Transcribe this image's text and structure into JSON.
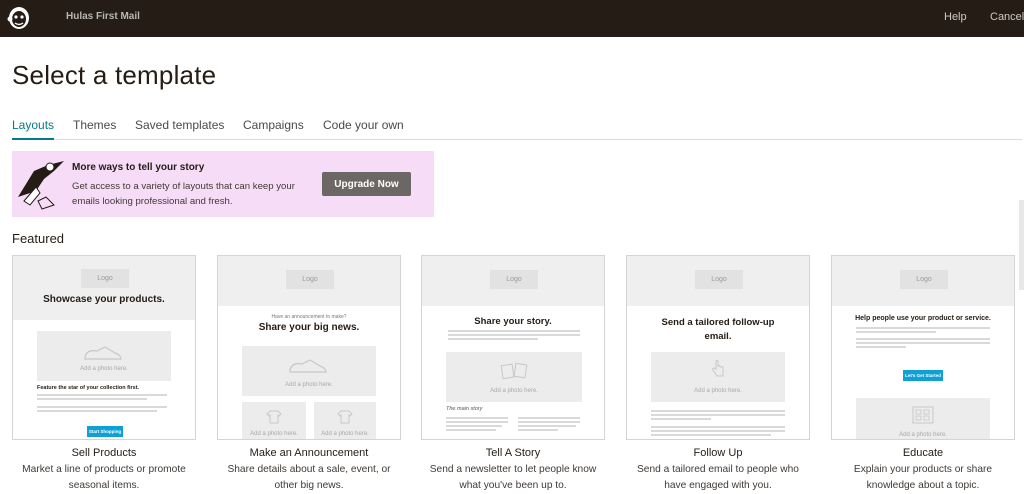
{
  "topbar": {
    "campaign_name": "Hulas First Mail",
    "help": "Help",
    "cancel": "Cancel"
  },
  "page_title": "Select a template",
  "tabs": [
    {
      "label": "Layouts",
      "active": true
    },
    {
      "label": "Themes",
      "active": false
    },
    {
      "label": "Saved templates",
      "active": false
    },
    {
      "label": "Campaigns",
      "active": false
    },
    {
      "label": "Code your own",
      "active": false
    }
  ],
  "promo": {
    "title": "More ways to tell your story",
    "text": "Get access to a variety of layouts that can keep your emails looking professional and fresh.",
    "button": "Upgrade Now"
  },
  "featured_heading": "Featured",
  "templates": [
    {
      "title": "Sell Products",
      "description": "Market a line of products or promote seasonal items.",
      "thumb": {
        "logo": "Logo",
        "headline": "Showcase your products.",
        "photo": "Add a photo here.",
        "feature": "Feature the star of your collection first.",
        "button": "Start Shopping"
      }
    },
    {
      "title": "Make an Announcement",
      "description": "Share details about a sale, event, or other big news.",
      "thumb": {
        "logo": "Logo",
        "kicker": "Have an announcement to make?",
        "headline": "Share your big news.",
        "photo": "Add a photo here.",
        "photo_small_1": "Add a photo here.",
        "photo_small_2": "Add a photo here."
      }
    },
    {
      "title": "Tell A Story",
      "description": "Send a newsletter to let people know what you've been up to.",
      "thumb": {
        "logo": "Logo",
        "headline": "Share your story.",
        "photo": "Add a photo here.",
        "main_story": "The main story"
      }
    },
    {
      "title": "Follow Up",
      "description": "Send a tailored email to people who have engaged with you.",
      "thumb": {
        "logo": "Logo",
        "headline": "Send a tailored follow-up email.",
        "photo": "Add a photo here."
      }
    },
    {
      "title": "Educate",
      "description": "Explain your products or share knowledge about a topic.",
      "thumb": {
        "logo": "Logo",
        "headline": "Help people use your product or service.",
        "button": "Let's Get Started",
        "photo": "Add a photo here."
      }
    }
  ],
  "colors": {
    "topbar": "#241c15",
    "accent": "#007c89",
    "promo_bg": "#f6dcf7",
    "upgrade_btn": "#6b6764",
    "thumb_button": "#11a0d3"
  }
}
